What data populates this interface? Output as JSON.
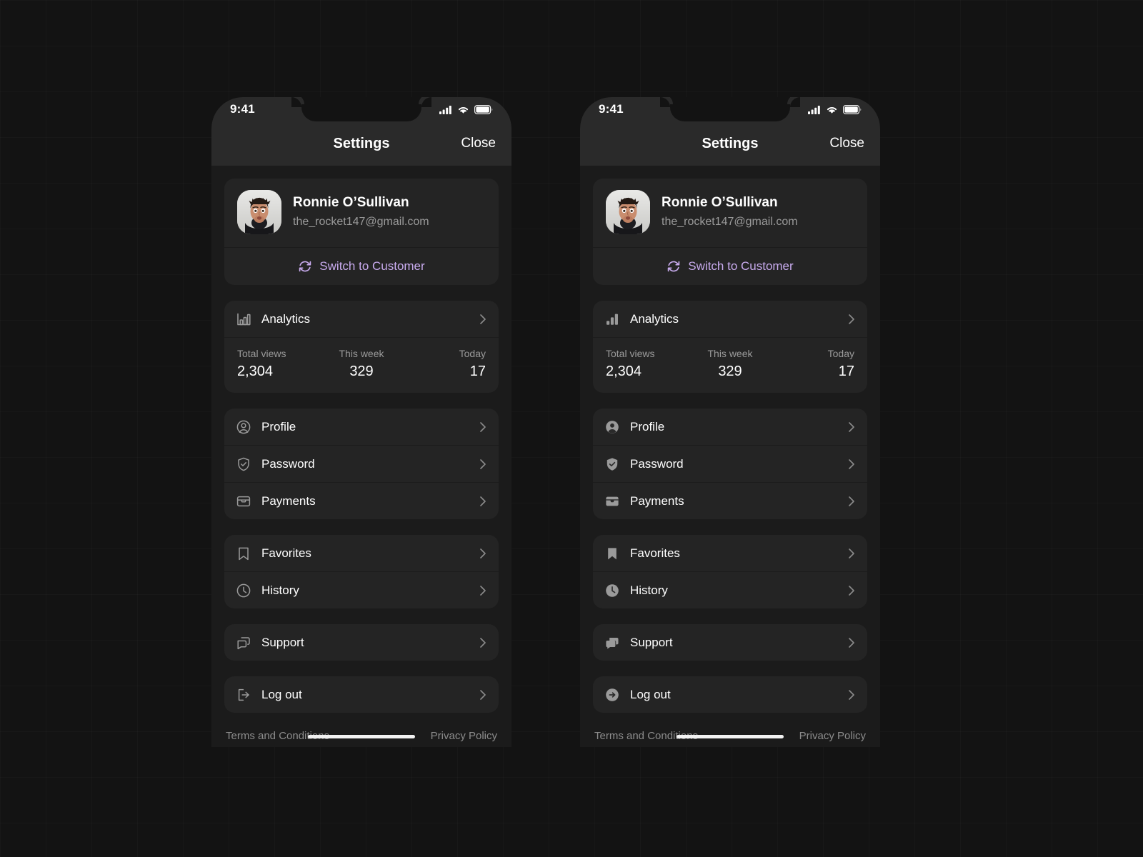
{
  "accent": {
    "purple": "#c8abee",
    "background": "#131313",
    "card": "#242424",
    "topbar": "#2a2a2a",
    "muted_text": "#9a9a9a",
    "chevron": "#8a8a8a"
  },
  "screens": [
    {
      "variant": "outline-icons",
      "status_bar": {
        "time": "9:41",
        "icons": [
          "cellular-signal-icon",
          "wifi-icon",
          "battery-icon"
        ]
      },
      "nav": {
        "title": "Settings",
        "close_label": "Close"
      },
      "profile": {
        "avatar_name": "user-avatar",
        "name": "Ronnie O’Sullivan",
        "email": "the_rocket147@gmail.com",
        "switch_label": "Switch to Customer",
        "switch_icon": "refresh-icon"
      },
      "analytics": {
        "label": "Analytics",
        "icon": "bar-chart-icon",
        "stats": [
          {
            "label": "Total views",
            "value": "2,304"
          },
          {
            "label": "This week",
            "value": "329"
          },
          {
            "label": "Today",
            "value": "17"
          }
        ]
      },
      "groups": [
        [
          {
            "label": "Profile",
            "icon": "user-circle-icon"
          },
          {
            "label": "Password",
            "icon": "shield-check-icon"
          },
          {
            "label": "Payments",
            "icon": "wallet-icon"
          }
        ],
        [
          {
            "label": "Favorites",
            "icon": "bookmark-icon"
          },
          {
            "label": "History",
            "icon": "clock-icon"
          }
        ],
        [
          {
            "label": "Support",
            "icon": "chat-icon"
          }
        ],
        [
          {
            "label": "Log out",
            "icon": "logout-icon"
          }
        ]
      ],
      "footer": {
        "terms_label": "Terms and Conditions",
        "privacy_label": "Privacy Policy"
      }
    },
    {
      "variant": "filled-icons",
      "status_bar": {
        "time": "9:41",
        "icons": [
          "cellular-signal-icon",
          "wifi-icon",
          "battery-icon"
        ]
      },
      "nav": {
        "title": "Settings",
        "close_label": "Close"
      },
      "profile": {
        "avatar_name": "user-avatar",
        "name": "Ronnie O’Sullivan",
        "email": "the_rocket147@gmail.com",
        "switch_label": "Switch to Customer",
        "switch_icon": "refresh-icon"
      },
      "analytics": {
        "label": "Analytics",
        "icon": "bar-chart-icon",
        "stats": [
          {
            "label": "Total views",
            "value": "2,304"
          },
          {
            "label": "This week",
            "value": "329"
          },
          {
            "label": "Today",
            "value": "17"
          }
        ]
      },
      "groups": [
        [
          {
            "label": "Profile",
            "icon": "user-circle-icon"
          },
          {
            "label": "Password",
            "icon": "shield-check-icon"
          },
          {
            "label": "Payments",
            "icon": "wallet-icon"
          }
        ],
        [
          {
            "label": "Favorites",
            "icon": "bookmark-icon"
          },
          {
            "label": "History",
            "icon": "clock-icon"
          }
        ],
        [
          {
            "label": "Support",
            "icon": "chat-icon"
          }
        ],
        [
          {
            "label": "Log out",
            "icon": "logout-icon"
          }
        ]
      ],
      "footer": {
        "terms_label": "Terms and Conditions",
        "privacy_label": "Privacy Policy"
      }
    }
  ]
}
